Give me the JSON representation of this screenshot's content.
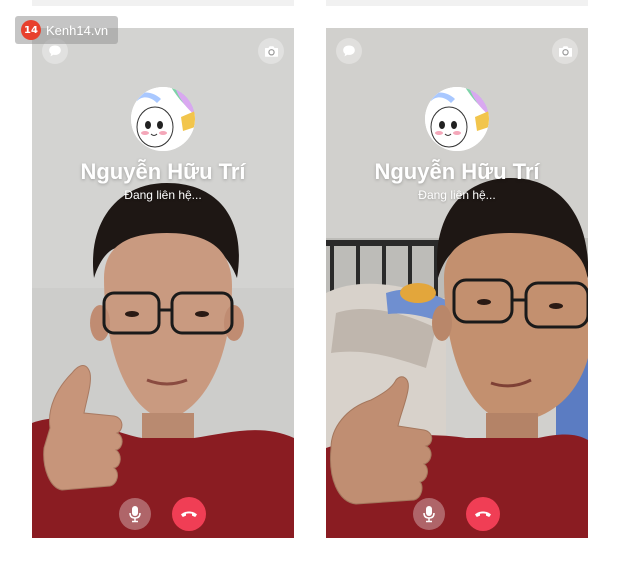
{
  "watermark": {
    "logo": "14",
    "text": "Kenh14.vn"
  },
  "calls": [
    {
      "caller_name": "Nguyễn Hữu Trí",
      "status": "Đang liên hệ...",
      "icons": {
        "chat": "chat-bubble-icon",
        "camera": "camera-switch-icon",
        "mic": "microphone-icon",
        "end": "phone-hangup-icon"
      }
    },
    {
      "caller_name": "Nguyễn Hữu Trí",
      "status": "Đang liên hệ...",
      "icons": {
        "chat": "chat-bubble-icon",
        "camera": "camera-switch-icon",
        "mic": "microphone-icon",
        "end": "phone-hangup-icon"
      }
    }
  ],
  "colors": {
    "end_call": "#f03e55",
    "shirt": "#8a1c22",
    "wall": "#cfcfcd"
  }
}
